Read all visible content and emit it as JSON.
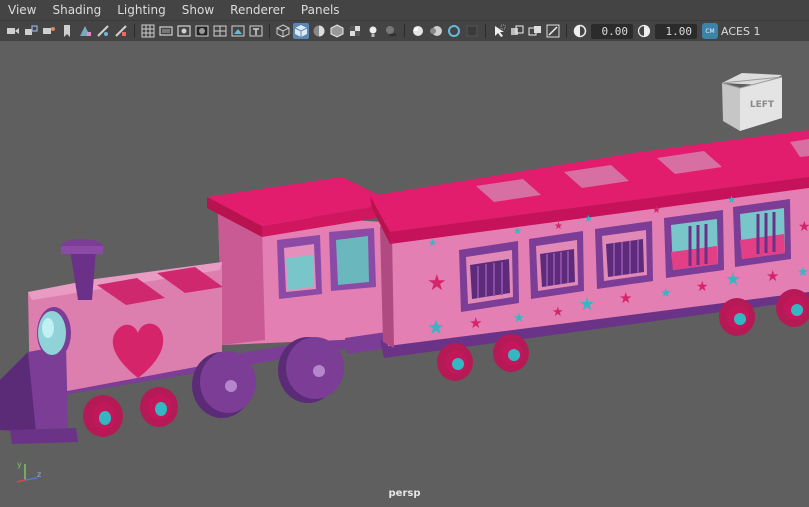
{
  "menus": [
    "View",
    "Shading",
    "Lighting",
    "Show",
    "Renderer",
    "Panels"
  ],
  "toolbar": {
    "exposure": "0.00",
    "gamma": "1.00",
    "colorspace": "ACES 1"
  },
  "viewcube": {
    "face": "LEFT"
  },
  "camera_label": "persp",
  "axis": {
    "y": "y",
    "z": "z"
  },
  "colors": {
    "roof": "#d0165f",
    "body": "#d86fa3",
    "purple": "#7b3d96",
    "wheel_red": "#c2185b",
    "teal": "#35b7c3"
  }
}
